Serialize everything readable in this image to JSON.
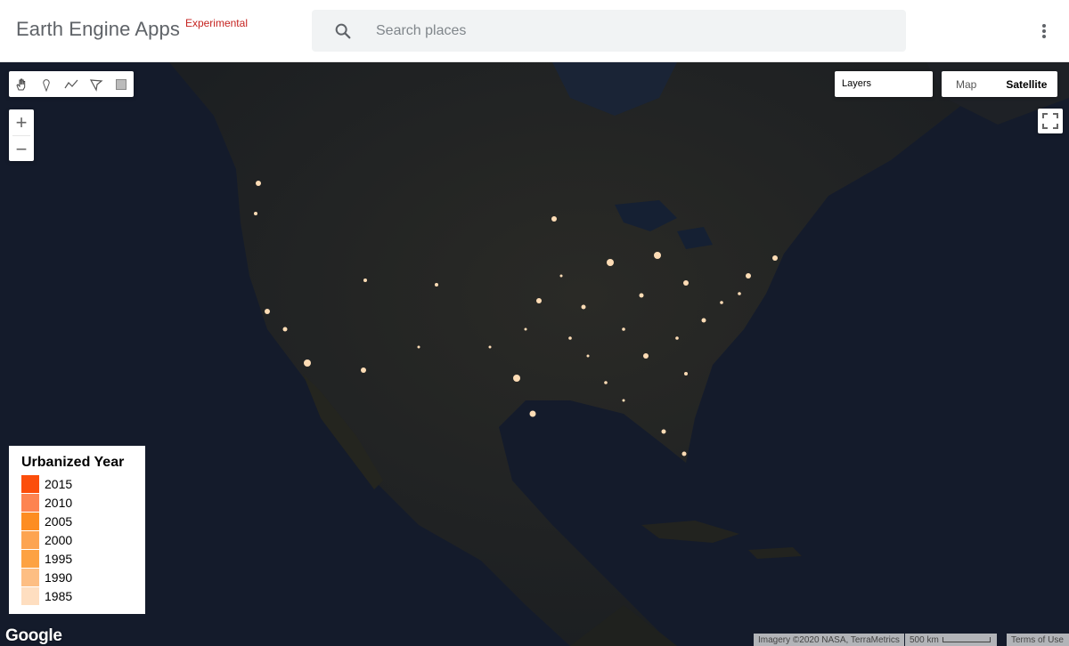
{
  "header": {
    "title": "Earth Engine Apps",
    "badge": "Experimental",
    "search_placeholder": "Search places",
    "search_icon": "search-icon",
    "more_icon": "more-vert-icon"
  },
  "map": {
    "draw_tools": [
      "hand-pan-icon",
      "point-marker-icon",
      "line-draw-icon",
      "polygon-draw-icon",
      "rectangle-draw-icon"
    ],
    "zoom_in_label": "+",
    "zoom_out_label": "−",
    "layers_label": "Layers",
    "map_type": {
      "options": [
        "Map",
        "Satellite"
      ],
      "selected": "Satellite"
    },
    "fullscreen_icon": "fullscreen-icon"
  },
  "legend": {
    "title": "Urbanized Year",
    "items": [
      {
        "label": "2015",
        "color": "#fc4e0b"
      },
      {
        "label": "2010",
        "color": "#fd8451"
      },
      {
        "label": "2005",
        "color": "#fd8d22"
      },
      {
        "label": "2000",
        "color": "#fda451"
      },
      {
        "label": "1995",
        "color": "#fda242"
      },
      {
        "label": "1990",
        "color": "#fdbe83"
      },
      {
        "label": "1985",
        "color": "#fedec0"
      }
    ]
  },
  "footer": {
    "logo": "Google",
    "imagery": "Imagery ©2020 NASA, TerraMetrics",
    "scale": "500 km",
    "terms": "Terms of Use"
  }
}
